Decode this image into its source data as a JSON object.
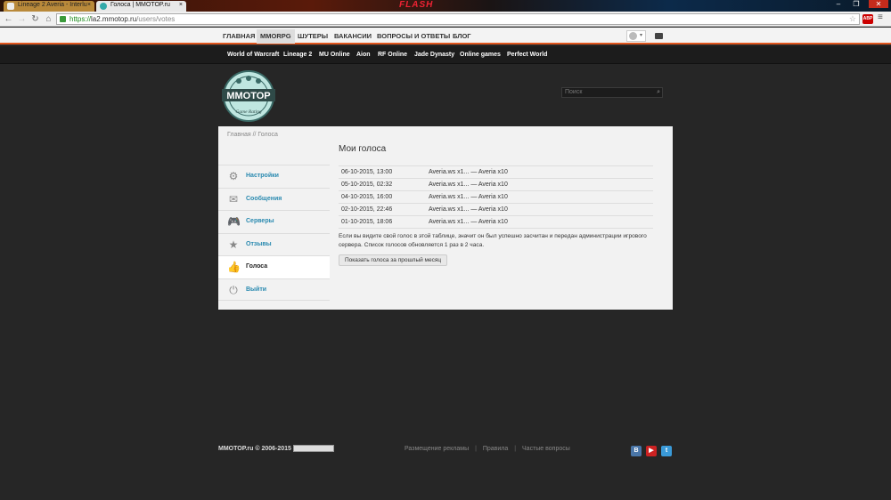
{
  "browser": {
    "tabs": [
      {
        "label": "Lineage 2 Averia - Interlu"
      },
      {
        "label": "Голоса | MMOTOP.ru"
      }
    ],
    "tab_close": "×",
    "banner_text": "FLASH",
    "url_scheme": "https://",
    "url_host": "la2.mmotop.ru",
    "url_path": "/users/votes",
    "abp_label": "ABP",
    "window_controls": {
      "minimize": "–",
      "restore": "❐",
      "close": "✕"
    }
  },
  "topnav": {
    "items": [
      {
        "label": "ГЛАВНАЯ"
      },
      {
        "label": "MMORPG"
      },
      {
        "label": "ШУТЕРЫ"
      },
      {
        "label": "ВАКАНСИИ"
      },
      {
        "label": "ВОПРОСЫ И ОТВЕТЫ"
      },
      {
        "label": "БЛОГ"
      }
    ],
    "active_index": 1
  },
  "subnav": {
    "items": [
      {
        "label": "World of Warcraft"
      },
      {
        "label": "Lineage 2"
      },
      {
        "label": "MU Online"
      },
      {
        "label": "Aion"
      },
      {
        "label": "RF Online"
      },
      {
        "label": "Jade Dynasty"
      },
      {
        "label": "Online games"
      },
      {
        "label": "Perfect World"
      }
    ]
  },
  "logo": {
    "title": "MMOTOP",
    "subtitle": "Game Rating"
  },
  "search": {
    "placeholder": "Поиск"
  },
  "breadcrumb": "Главная // Голоса",
  "sidebar": {
    "items": [
      {
        "label": "Настройки",
        "icon": "gear-icon"
      },
      {
        "label": "Сообщения",
        "icon": "envelope-icon"
      },
      {
        "label": "Серверы",
        "icon": "gamepad-icon"
      },
      {
        "label": "Отзывы",
        "icon": "star-icon"
      },
      {
        "label": "Голоса",
        "icon": "thumbs-up-icon",
        "active": true
      },
      {
        "label": "Выйти",
        "icon": "power-icon"
      }
    ]
  },
  "content": {
    "title": "Мои голоса",
    "votes": [
      {
        "date": "06-10-2015, 13:00",
        "server": "Averia.ws x1... — Averia x10"
      },
      {
        "date": "05-10-2015, 02:32",
        "server": "Averia.ws x1... — Averia x10"
      },
      {
        "date": "04-10-2015, 16:00",
        "server": "Averia.ws x1... — Averia x10"
      },
      {
        "date": "02-10-2015, 22:46",
        "server": "Averia.ws x1... — Averia x10"
      },
      {
        "date": "01-10-2015, 18:06",
        "server": "Averia.ws x1... — Averia x10"
      }
    ],
    "note": "Если вы видите свой голос в этой таблице, значит он был успешно засчитан и передан администрации игрового сервера. Список голосов обновляется 1 раз в 2 часа.",
    "prev_month_button": "Показать голоса за прошлый месяц"
  },
  "footer": {
    "copyright": "MMOTOP.ru © 2006-2015",
    "links": [
      {
        "label": "Размещение рекламы"
      },
      {
        "label": "Правила"
      },
      {
        "label": "Частые вопросы"
      }
    ],
    "separator": "|",
    "social": [
      {
        "icon": "vk-icon",
        "label": "В",
        "color": "#4a76a8"
      },
      {
        "icon": "youtube-icon",
        "label": "▶",
        "color": "#cc2222"
      },
      {
        "icon": "twitter-icon",
        "label": "t",
        "color": "#3a9ad8"
      }
    ]
  },
  "colors": {
    "accent": "#e0561e",
    "link": "#2a8ab0",
    "page_bg": "#262626",
    "panel_bg": "#f2f2f2"
  }
}
